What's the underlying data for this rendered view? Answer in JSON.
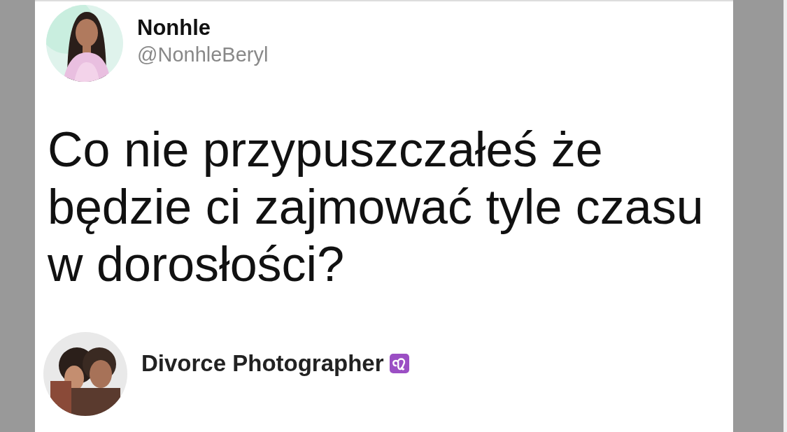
{
  "tweet": {
    "author": {
      "name": "Nonhle",
      "handle": "@NonhleBeryl"
    },
    "text": "Co nie przypuszczałeś że będzie ci zajmować tyle czasu w dorosłości?"
  },
  "reply": {
    "author": {
      "name": "Divorce Photographer"
    }
  }
}
